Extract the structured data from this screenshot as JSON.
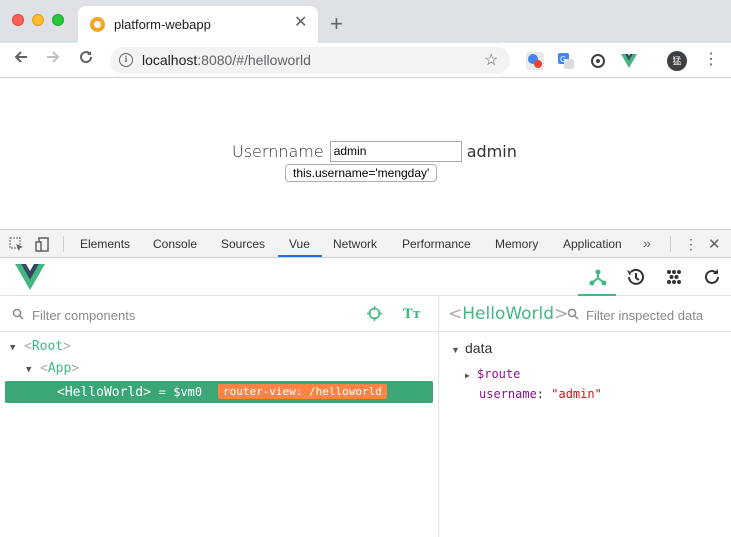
{
  "browser": {
    "tab_title": "platform-webapp",
    "tab_close": "✕",
    "new_tab": "+",
    "url_host": "localhost",
    "url_rest": ":8080/#/helloworld",
    "profile_initial": "猛"
  },
  "page": {
    "username_label": "Usernname",
    "username_input_value": "admin",
    "username_display": "admin",
    "set_button_label": "this.username='mengday'"
  },
  "devtools": {
    "tabs": [
      "Elements",
      "Console",
      "Sources",
      "Vue",
      "Network",
      "Performance",
      "Memory",
      "Application"
    ],
    "active_tab": "Vue",
    "more": "»",
    "close": "✕"
  },
  "vue": {
    "filter_components_placeholder": "Filter components",
    "tree": {
      "root": "Root",
      "app": "App",
      "selected": "HelloWorld",
      "vm_ref": "= $vm0",
      "router_tag": "router-view: /helloworld"
    },
    "inspector": {
      "component": "HelloWorld",
      "filter_placeholder": "Filter inspected data",
      "section": "data",
      "route_key": "$route",
      "username_key": "username",
      "username_value": "\"admin\""
    },
    "accent_color": "#42b983",
    "router_tag_color": "#ff8344"
  }
}
